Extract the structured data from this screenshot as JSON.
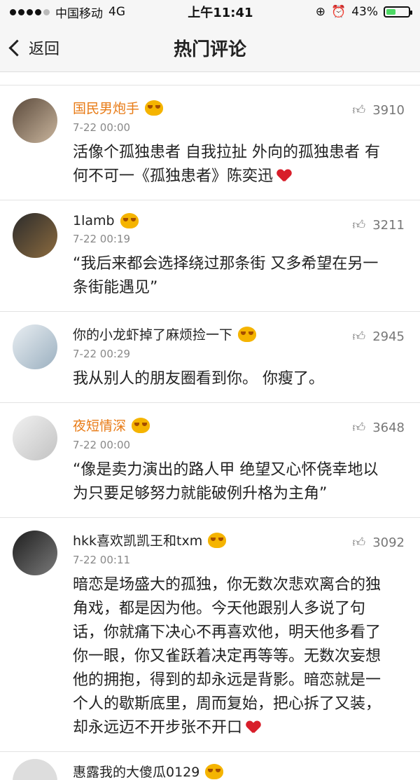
{
  "status": {
    "carrier": "中国移动",
    "network": "4G",
    "time": "上午11:41",
    "battery": "43%",
    "battery_level": 0.43
  },
  "nav": {
    "back": "返回",
    "title": "热门评论"
  },
  "colors": {
    "name_highlight": "#e87b16",
    "heart": "#d81e2a"
  },
  "comments": [
    {
      "name": "国民男炮手",
      "name_style": "orange",
      "time": "7-22 00:00",
      "likes": "3910",
      "text": "活像个孤独患者 自我拉扯 外向的孤独患者 有何不可一《孤独患者》陈奕迅",
      "heart": true
    },
    {
      "name": "1lamb",
      "name_style": "dark",
      "time": "7-22 00:19",
      "likes": "3211",
      "text": "“我后来都会选择绕过那条街 又多希望在另一条街能遇见”",
      "heart": false
    },
    {
      "name": "你的小龙虾掉了麻烦捡一下",
      "name_style": "dark",
      "time": "7-22 00:29",
      "likes": "2945",
      "text": "我从别人的朋友圈看到你。 你瘦了。",
      "heart": false
    },
    {
      "name": "夜短情深",
      "name_style": "orange",
      "time": "7-22 00:00",
      "likes": "3648",
      "text": "“像是卖力演出的路人甲  绝望又心怀侥幸地以为只要足够努力就能破例升格为主角”",
      "heart": false
    },
    {
      "name": "hkk喜欢凯凯王和txm",
      "name_style": "dark",
      "time": "7-22 00:11",
      "likes": "3092",
      "text": "暗恋是场盛大的孤独，你无数次悲欢离合的独角戏，都是因为他。今天他跟别人多说了句话，你就痛下决心不再喜欢他，明天他多看了你一眼，你又雀跃着决定再等等。无数次妄想他的拥抱，得到的却永远是背影。暗恋就是一个人的歇斯底里，周而复始，把心拆了又装，却永远迈不开步张不开口",
      "heart": true
    }
  ],
  "partial_name": "惠露我的大傻瓜0129"
}
